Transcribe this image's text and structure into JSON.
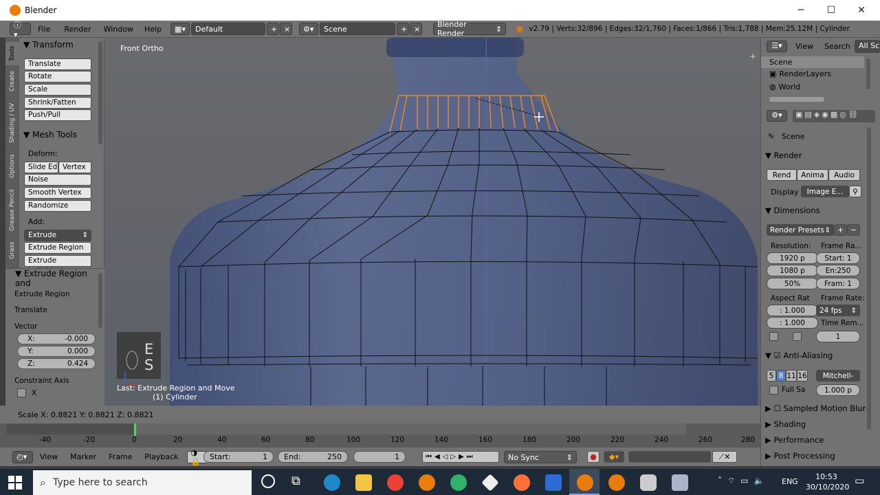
{
  "window": {
    "title": "Blender"
  },
  "infobar": {
    "menus": [
      "File",
      "Render",
      "Window",
      "Help"
    ],
    "layout": "Default",
    "scene": "Scene",
    "engine": "Blender Render",
    "stats": "v2.79 | Verts:32/896 | Edges:32/1,760 | Faces:1/866 | Tris:1,788 | Mem:25.12M | Cylinder"
  },
  "tabs": [
    "Tools",
    "Create",
    "Shading / UV",
    "Options",
    "Grease Pencil",
    "Grass"
  ],
  "toolshelf": {
    "transform_title": "Transform",
    "transform_buttons": [
      "Translate",
      "Rotate",
      "Scale",
      "Shrink/Fatten",
      "Push/Pull"
    ],
    "meshtools_title": "Mesh Tools",
    "deform_label": "Deform:",
    "slide_edge": "Slide Ed",
    "vertex": "Vertex",
    "deform_buttons": [
      "Noise",
      "Smooth Vertex",
      "Randomize"
    ],
    "add_label": "Add:",
    "extrude": "Extrude",
    "add_buttons": [
      "Extrude Region",
      "Extrude Individual"
    ],
    "operator_title": "Extrude Region and",
    "operator_name": "Extrude Region",
    "operator_sub": "Translate",
    "vector_label": "Vector",
    "vector": [
      {
        "axis": "X:",
        "value": "-0.000"
      },
      {
        "axis": "Y:",
        "value": "0.000"
      },
      {
        "axis": "Z:",
        "value": "0.424"
      }
    ],
    "constraint_label": "Constraint Axis",
    "constraint_x": "X"
  },
  "viewport": {
    "label": "Front Ortho",
    "keys": [
      "E",
      "S"
    ],
    "last_op": "Last: Extrude Region and Move",
    "object": "(1) Cylinder"
  },
  "outliner": {
    "view": "View",
    "search": "Search",
    "filter": "All Sc",
    "items": [
      "Scene",
      "RenderLayers",
      "World"
    ]
  },
  "properties": {
    "context": "Scene",
    "render_title": "Render",
    "render_buttons": [
      "Rend",
      "Anima",
      "Audio"
    ],
    "display_label": "Display",
    "display_value": "Image E...",
    "dimensions_title": "Dimensions",
    "presets": "Render Presets",
    "resolution_label": "Resolution:",
    "framerange_label": "Frame Ra...",
    "res_x": "1920 p",
    "res_y": "1080 p",
    "res_pct": "50%",
    "start": "Start: 1",
    "end": "En:250",
    "frame": "Fram: 1",
    "aspect_label": "Aspect Rat",
    "framerate_label": "Frame Rate:",
    "aspect_x": ": 1.000",
    "aspect_y": ": 1.000",
    "fps": "24 fps",
    "time_remap": "Time Rem...",
    "time_value": "1",
    "aa_title": "Anti-Aliasing",
    "aa_samples": [
      "5",
      "8",
      "11",
      "16"
    ],
    "aa_filter": "Mitchell-",
    "full_sample": "Full Sa",
    "aa_size": "1.000 p",
    "collapsed": [
      "Sampled Motion Blur",
      "Shading",
      "Performance",
      "Post Processing"
    ]
  },
  "status": {
    "scale": "Scale X: 0.8821  Y: 0.8821  Z: 0.8821"
  },
  "timeline": {
    "ticks": [
      "-40",
      "-20",
      "0",
      "20",
      "40",
      "60",
      "80",
      "100",
      "120",
      "140",
      "160",
      "180",
      "200",
      "220",
      "240",
      "260",
      "280"
    ]
  },
  "timebar": {
    "menus": [
      "View",
      "Marker",
      "Frame",
      "Playback"
    ],
    "start_label": "Start:",
    "start_value": "1",
    "end_label": "End:",
    "end_value": "250",
    "current": "1",
    "sync": "No Sync"
  },
  "taskbar": {
    "search_placeholder": "Type here to search",
    "lang": "ENG",
    "time": "10:53",
    "date": "30/10/2020"
  },
  "colors": {
    "selection": "#ff8c1a",
    "accent": "#5680c2"
  }
}
